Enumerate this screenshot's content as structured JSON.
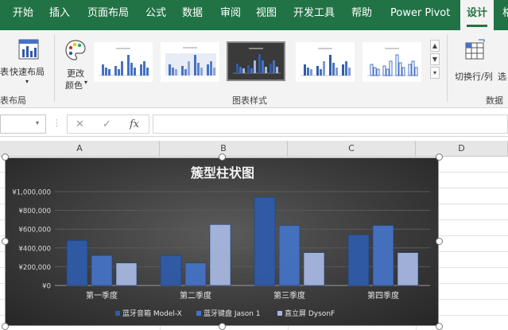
{
  "ribbon_tabs": [
    {
      "label": "开始"
    },
    {
      "label": "插入"
    },
    {
      "label": "页面布局"
    },
    {
      "label": "公式"
    },
    {
      "label": "数据"
    },
    {
      "label": "审阅"
    },
    {
      "label": "视图"
    },
    {
      "label": "开发工具"
    },
    {
      "label": "帮助"
    },
    {
      "label": "Power Pivot"
    },
    {
      "label": "设计",
      "active": true
    },
    {
      "label": "格"
    }
  ],
  "ribbon": {
    "partial_left_label": "表",
    "quick_layout_label": "快速布局",
    "chart_layout_group": "表布局",
    "change_colors_line1": "更改",
    "change_colors_line2": "颜色",
    "chart_styles_group": "图表样式",
    "switch_row_col_label": "切换行/列",
    "select_data_partial": "选",
    "data_group": "数据",
    "selected_style_index": 3
  },
  "formula_bar": {
    "cancel_symbol": "✕",
    "enter_symbol": "✓",
    "fx_symbol": "fx",
    "name_box_value": "",
    "formula_value": ""
  },
  "columns": [
    {
      "label": "A"
    },
    {
      "label": "B"
    },
    {
      "label": "C"
    },
    {
      "label": "D"
    }
  ],
  "chart_data": {
    "type": "bar",
    "title": "簇型柱状图",
    "categories": [
      "第一季度",
      "第二季度",
      "第三季度",
      "第四季度"
    ],
    "series": [
      {
        "name": "蓝牙音箱 Model-X",
        "values": [
          480000,
          320000,
          940000,
          540000
        ],
        "color": "#2f5ba8"
      },
      {
        "name": "蓝牙键盘 Jason 1",
        "values": [
          320000,
          240000,
          640000,
          640000
        ],
        "color": "#4472c4"
      },
      {
        "name": "直立屏 DysonF",
        "values": [
          240000,
          650000,
          350000,
          350000
        ],
        "color": "#a6b6df"
      }
    ],
    "ylim": [
      0,
      1000000
    ],
    "yticks": [
      0,
      200000,
      400000,
      600000,
      800000,
      1000000
    ],
    "ytick_labels": [
      "¥0",
      "¥200,000",
      "¥400,000",
      "¥600,000",
      "¥800,000",
      "¥1,000,000"
    ],
    "legend_position": "bottom",
    "grid": true,
    "background": "#3c3c3c"
  }
}
